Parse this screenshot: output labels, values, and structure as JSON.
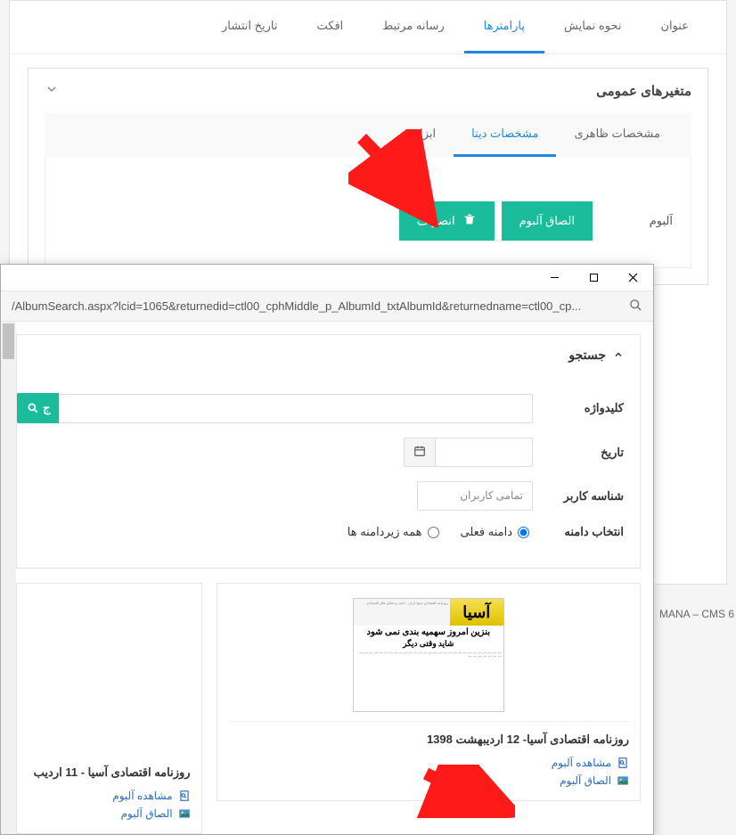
{
  "tabs": {
    "title": "عنوان",
    "display": "نحوه نمایش",
    "params": "پارامترها",
    "media": "رسانه مرتبط",
    "effect": "افکت",
    "publish": "تاریخ انتشار"
  },
  "section": {
    "title": "متغیرهای عمومی",
    "sub_visual": "مشخصات ظاهری",
    "sub_data": "مشخصات دیتا",
    "sub_tool": "ابزار"
  },
  "form": {
    "album_label": "آلبوم",
    "attach_btn": "الصاق آلبوم",
    "cancel_btn": "انصراف"
  },
  "popup": {
    "url": "/AlbumSearch.aspx?lcid=1065&returnedid=ctl00_cphMiddle_p_AlbumId_txtAlbumId&returnedname=ctl00_cp...",
    "search_title": "جستجو",
    "keyword_label": "کلیدواژه",
    "date_label": "تاریخ",
    "user_label": "شناسه کاربر",
    "user_value": "تمامی کاربران",
    "domain_label": "انتخاب دامنه",
    "domain_current": "دامنه فعلی",
    "domain_all": "همه زیردامنه ها",
    "search_addon": "ج",
    "result1": {
      "title": "روزنامه اقتصادی آسیا- 12 اردیبهشت 1398",
      "view": "مشاهده آلبوم",
      "attach": "الصاق آلبوم"
    },
    "result2": {
      "title": "روزنامه اقتصادی آسیا - 11 اردیب",
      "view": "مشاهده آلبوم",
      "attach": "الصاق آلبوم"
    },
    "news_head1": "بنزین امروز سهمیه بندی نمی شود",
    "news_head2": "شاید وقتی دیگر",
    "news_logo": "آسیا"
  },
  "brand": "MANA – CMS 6"
}
